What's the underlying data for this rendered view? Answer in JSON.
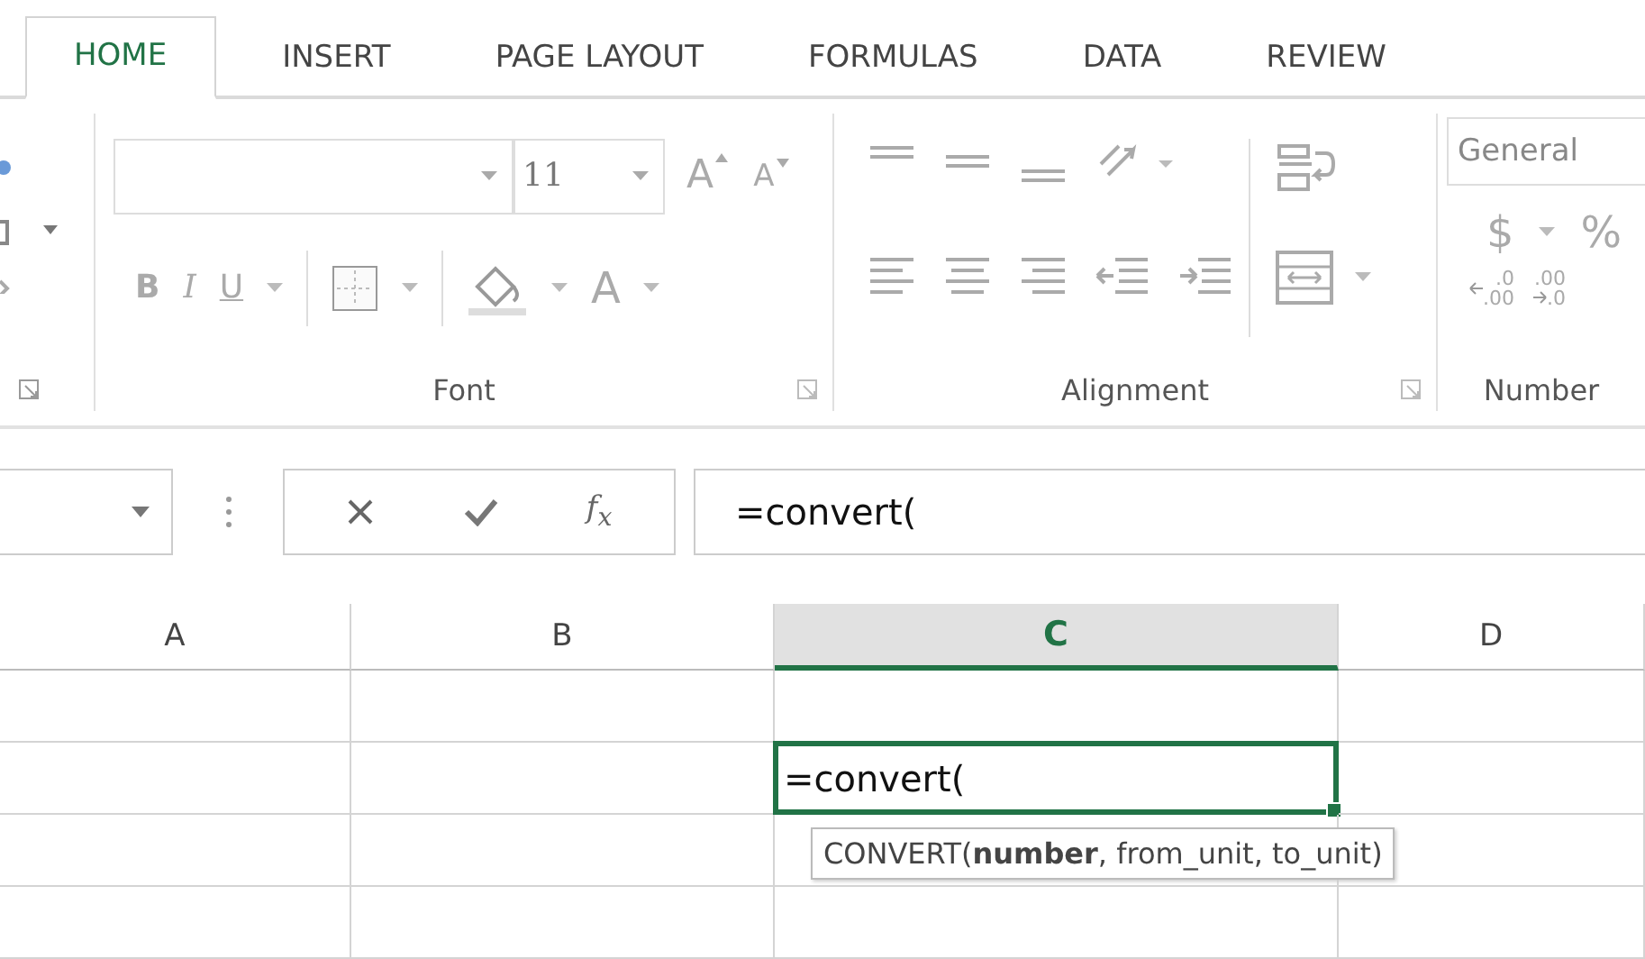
{
  "tabs": [
    {
      "label": "HOME",
      "selected": true
    },
    {
      "label": "INSERT",
      "selected": false
    },
    {
      "label": "PAGE LAYOUT",
      "selected": false
    },
    {
      "label": "FORMULAS",
      "selected": false
    },
    {
      "label": "DATA",
      "selected": false
    },
    {
      "label": "REVIEW",
      "selected": false
    }
  ],
  "ribbon": {
    "font": {
      "label": "Font",
      "size": "11",
      "grow": "A",
      "shrink": "A",
      "bold": "B",
      "italic": "I",
      "underline": "U",
      "font_color": "A"
    },
    "alignment": {
      "label": "Alignment"
    },
    "number": {
      "label": "Number",
      "format": "General",
      "currency": "$",
      "percent": "%",
      "increase_decimal": {
        "top": ".0",
        "bottom": ".00"
      },
      "decrease_decimal": {
        "top": ".00",
        "bottom": ".0"
      }
    }
  },
  "formula_bar": {
    "insert_function": "f$_{x}$",
    "value": "=convert("
  },
  "columns": [
    {
      "label": "A",
      "selected": false
    },
    {
      "label": "B",
      "selected": false
    },
    {
      "label": "C",
      "selected": true
    },
    {
      "label": "D",
      "selected": false
    }
  ],
  "rows": [
    {
      "cells": [
        {
          "active": false
        },
        {
          "active": false
        },
        {
          "active": false
        },
        {
          "active": false
        }
      ]
    },
    {
      "cells": [
        {
          "active": false
        },
        {
          "active": false
        },
        {
          "value": "=convert(",
          "active": true
        },
        {
          "active": false
        }
      ]
    },
    {
      "cells": [
        {
          "active": false
        },
        {
          "active": false
        },
        {
          "active": false
        },
        {
          "active": false
        }
      ]
    },
    {
      "cells": [
        {
          "active": false
        },
        {
          "active": false
        },
        {
          "active": false
        },
        {
          "active": false
        }
      ]
    }
  ],
  "tooltip": "CONVERT(**number**, from_unit, to_unit)"
}
